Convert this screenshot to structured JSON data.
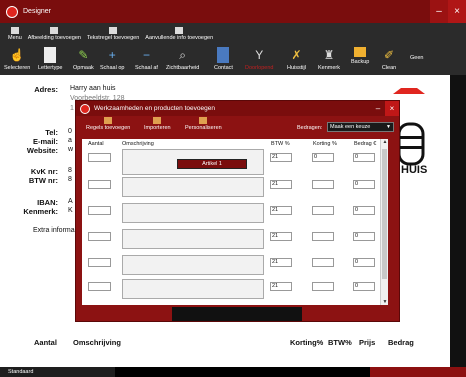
{
  "window": {
    "title": "Designer"
  },
  "menu": [
    {
      "label": "Menu"
    },
    {
      "label": "Afbeelding toevoegen"
    },
    {
      "label": "Tekstregel toevoegen"
    },
    {
      "label": "Aanvullende info toevoegen"
    }
  ],
  "tools": [
    {
      "label": "Selecteren",
      "icon": "hand-icon"
    },
    {
      "label": "Lettertype",
      "icon": "font-icon"
    },
    {
      "label": "Opmaak",
      "icon": "pen-icon"
    },
    {
      "label": "Schaal op",
      "icon": "plus-icon"
    },
    {
      "label": "Schaal af",
      "icon": "minus-icon"
    },
    {
      "label": "Zichtbaarheid",
      "icon": "magnifier-icon"
    },
    {
      "label": "Contact",
      "icon": "contact-icon"
    },
    {
      "label": "Doorlopend",
      "icon": "cup-icon"
    },
    {
      "label": "Huisstijl",
      "icon": "palette-icon"
    },
    {
      "label": "Kenmerk",
      "icon": "stamp-icon"
    },
    {
      "label": "Backup",
      "icon": "folder-icon"
    },
    {
      "label": "Clean",
      "icon": "broom-icon"
    },
    {
      "label": "Geen",
      "icon": "none"
    }
  ],
  "document": {
    "adres_label": "Adres:",
    "adres_name": "Harry aan huis",
    "adres_street": "Voorbeeldstr. 128",
    "adres_line3": "1",
    "tel_label": "Tel:",
    "tel_value": "0",
    "email_label": "E-mail:",
    "email_value": "a",
    "website_label": "Website:",
    "website_value": "w",
    "kvk_label": "KvK nr:",
    "kvk_value": "8",
    "btw_label": "BTW nr:",
    "btw_value": "8",
    "iban_label": "IBAN:",
    "iban_value": "A",
    "kenmerk_label": "Kenmerk:",
    "kenmerk_value": "K",
    "extra_info": "Extra informa",
    "logo_text": "HUIS"
  },
  "footer": {
    "aantal": "Aantal",
    "omschrijving": "Omschrijving",
    "korting": "Korting%",
    "btw": "BTW%",
    "prijs": "Prijs",
    "bedrag": "Bedrag"
  },
  "statusbar": {
    "text": "Standaard"
  },
  "dialog": {
    "title": "Werkzaamheden en producten toevoegen",
    "tools": [
      {
        "label": "Regels toevoegen"
      },
      {
        "label": "Importeren"
      },
      {
        "label": "Personaliseren"
      }
    ],
    "bedrag_label": "Bedragen:",
    "bedrag_select": "Maak een keuze",
    "columns": {
      "aantal": "Aantal",
      "omschrijving": "Omschrijving",
      "btw": "BTW %",
      "korting": "Korting %",
      "bedrag": "Bedrag €"
    },
    "dropdown_item": "Artikel 1",
    "rows": [
      {
        "aantal": "",
        "btw": "21",
        "korting": "0",
        "bedrag": "0"
      },
      {
        "aantal": "",
        "btw": "21",
        "korting": "",
        "bedrag": "0"
      },
      {
        "aantal": "",
        "btw": "21",
        "korting": "",
        "bedrag": "0"
      },
      {
        "aantal": "",
        "btw": "21",
        "korting": "",
        "bedrag": "0"
      },
      {
        "aantal": "",
        "btw": "21",
        "korting": "",
        "bedrag": "0"
      },
      {
        "aantal": "",
        "btw": "21",
        "korting": "",
        "bedrag": "0"
      }
    ]
  }
}
